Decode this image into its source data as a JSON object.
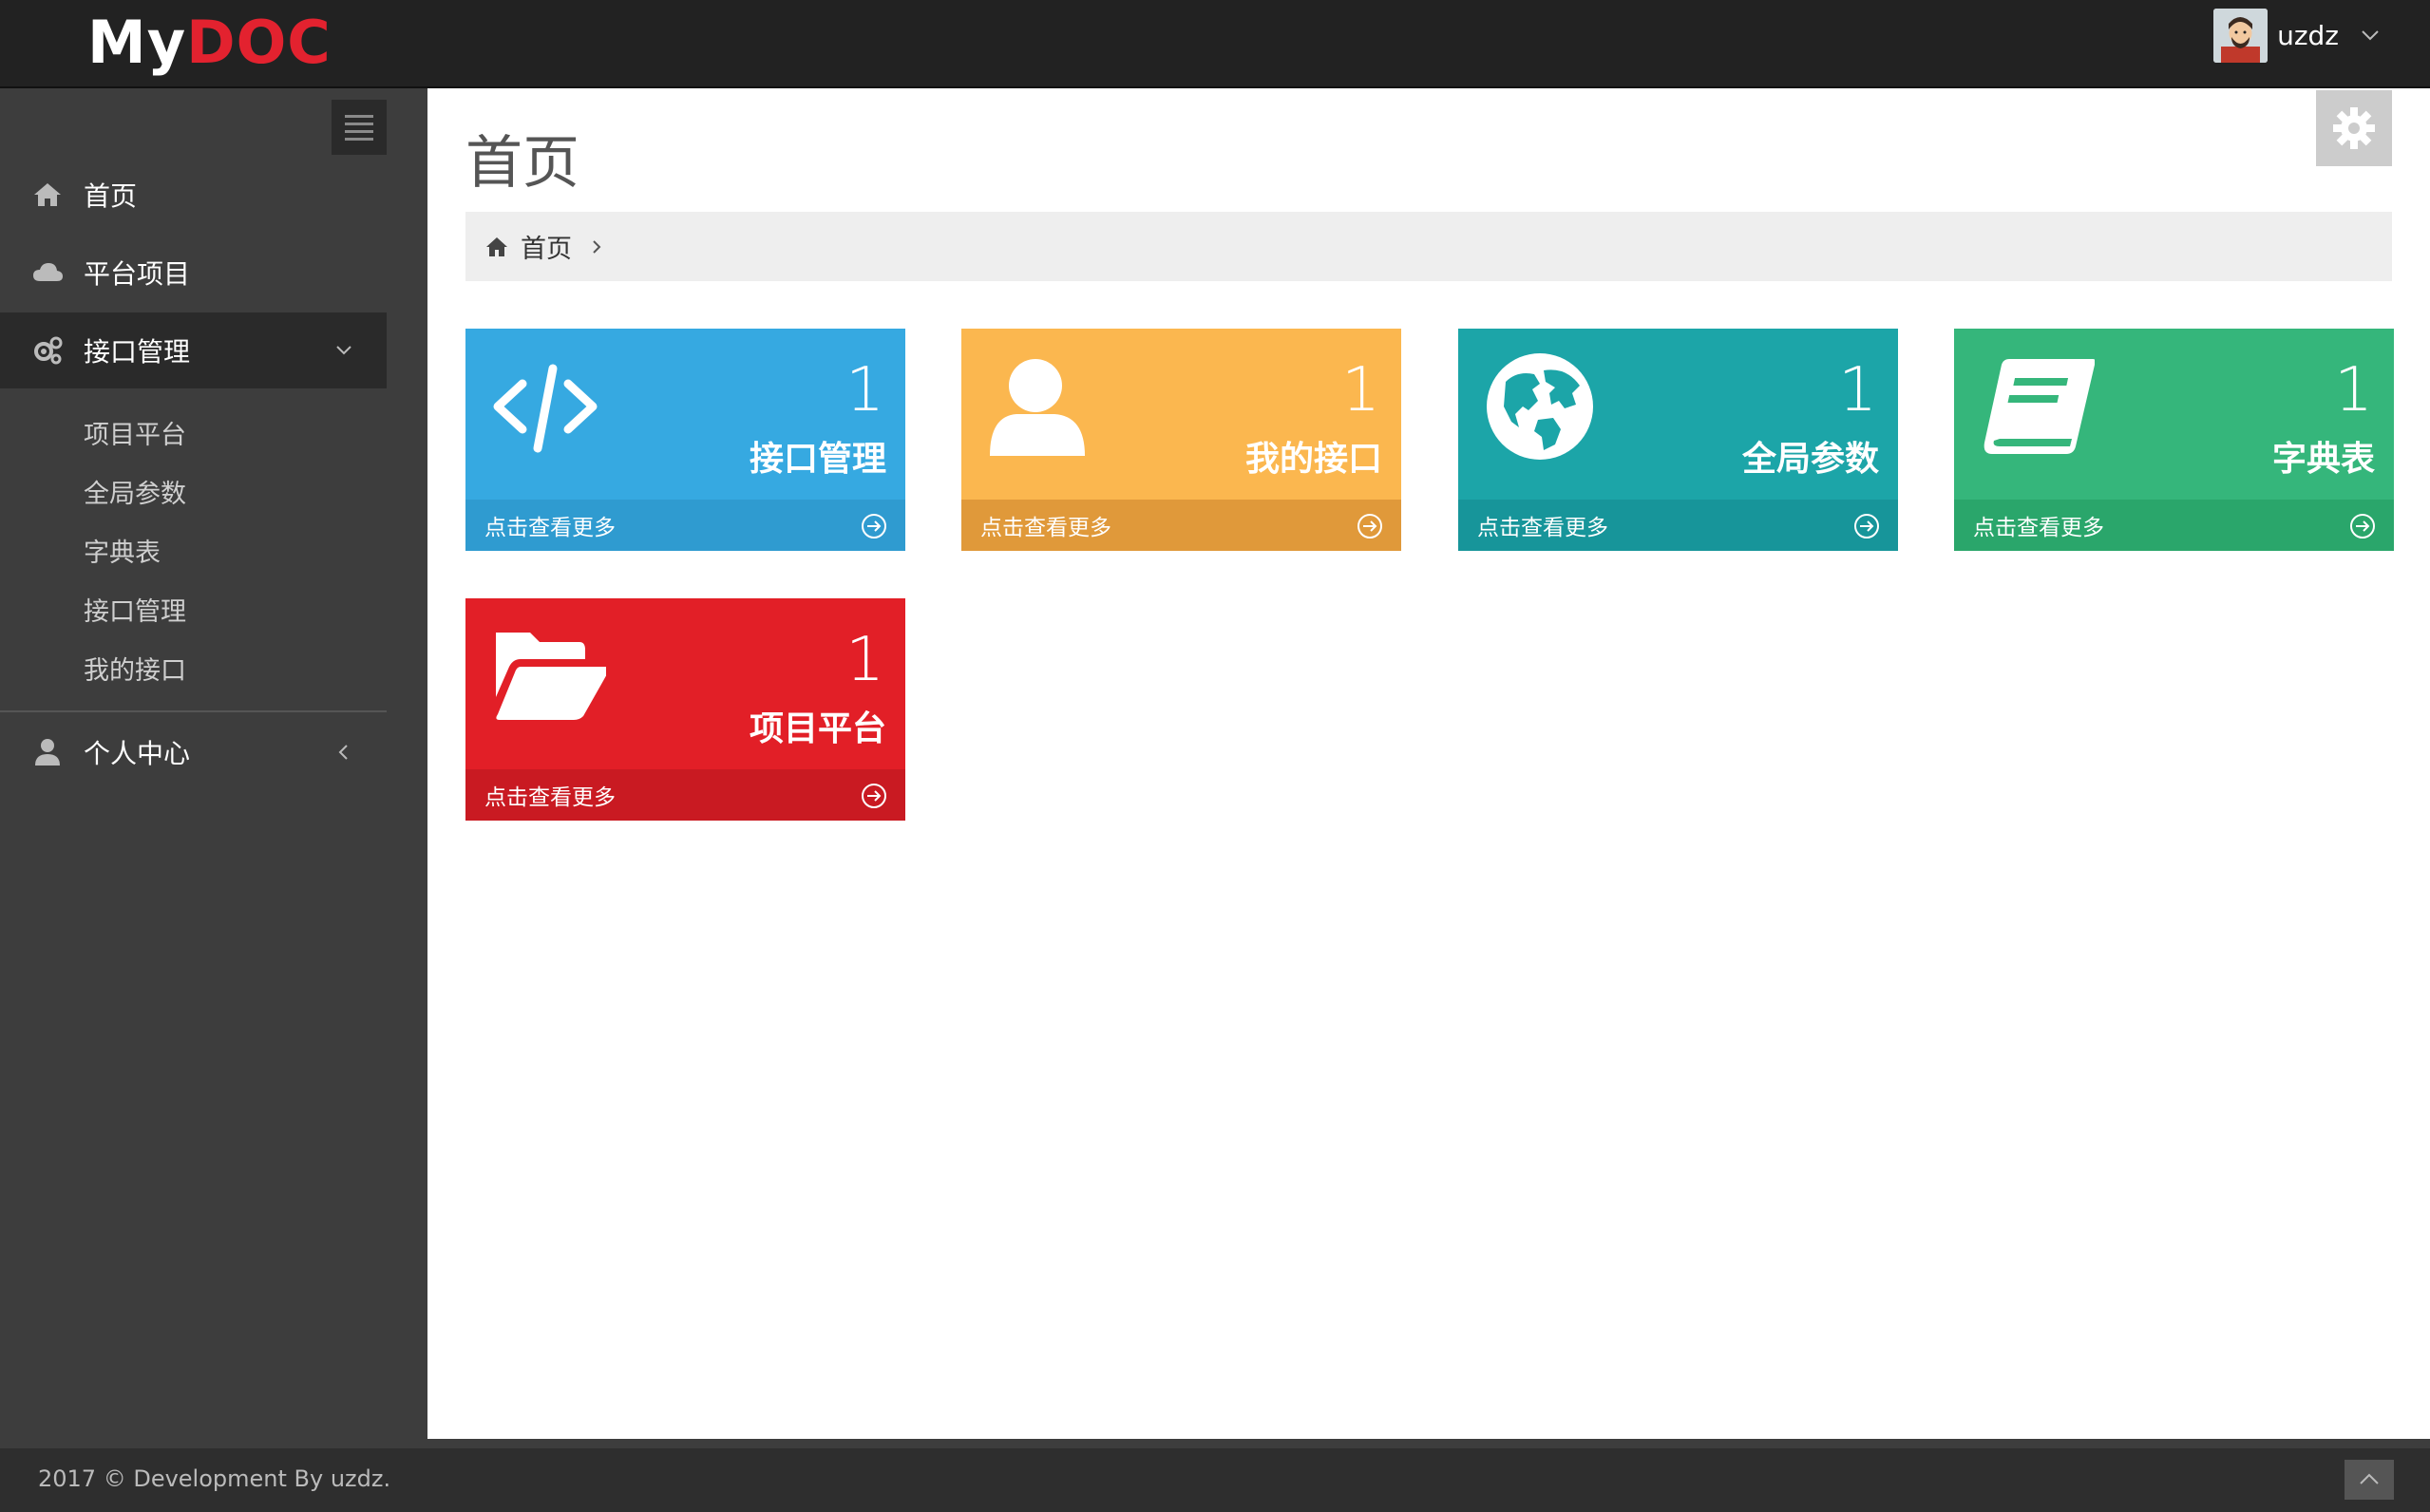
{
  "app": {
    "logo_my": "My",
    "logo_doc": "DOC",
    "username": "uzdz"
  },
  "sidebar": {
    "items": [
      {
        "label": "首页",
        "icon": "home-icon"
      },
      {
        "label": "平台项目",
        "icon": "cloud-icon"
      },
      {
        "label": "接口管理",
        "icon": "cogs-icon",
        "expanded": true
      },
      {
        "label": "个人中心",
        "icon": "user-icon",
        "expanded": false
      }
    ],
    "sub_items": [
      "项目平台",
      "全局参数",
      "字典表",
      "接口管理",
      "我的接口"
    ]
  },
  "main": {
    "page_title": "首页",
    "breadcrumb": {
      "label": "首页"
    },
    "tiles": [
      {
        "count": "1",
        "title": "接口管理",
        "more": "点击查看更多",
        "icon": "code-icon",
        "color": "#36a9e1",
        "footer_color": "#2f9bd0"
      },
      {
        "count": "1",
        "title": "我的接口",
        "more": "点击查看更多",
        "icon": "user-icon",
        "color": "#fbb74f",
        "footer_color": "#e0993a"
      },
      {
        "count": "1",
        "title": "全局参数",
        "more": "点击查看更多",
        "icon": "globe-icon",
        "color": "#1ca5a8",
        "footer_color": "#17959a"
      },
      {
        "count": "1",
        "title": "字典表",
        "more": "点击查看更多",
        "icon": "book-icon",
        "color": "#35b67b",
        "footer_color": "#2aa66b"
      },
      {
        "count": "1",
        "title": "项目平台",
        "more": "点击查看更多",
        "icon": "folder-open-icon",
        "color": "#e21f27",
        "footer_color": "#c91a22"
      }
    ]
  },
  "footer": {
    "text": "2017 © Development By uzdz."
  }
}
